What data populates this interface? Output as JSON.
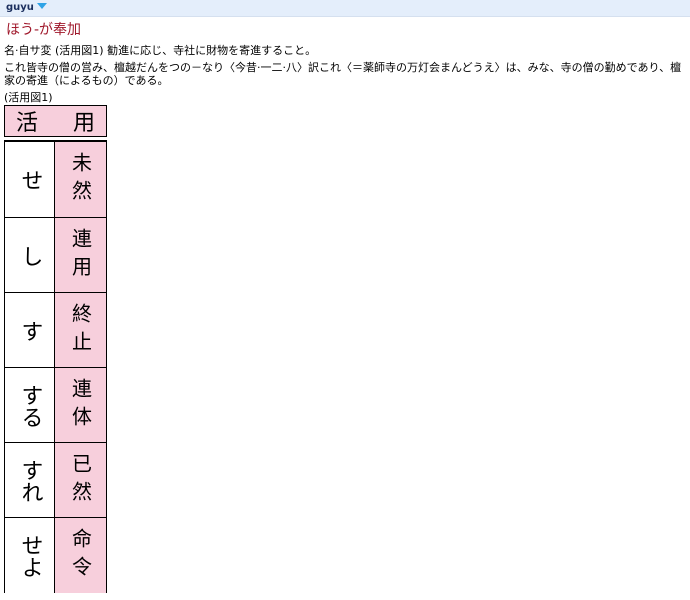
{
  "header": {
    "dictionary": "guyu"
  },
  "entry": {
    "headword": "ほう-が奉加",
    "grammar": "名·自サ変 (活用図1) 勧進に応じ、寺社に財物を寄進すること。",
    "text": "これ皆寺の僧の営み、檀越だんをつの－なり〈今昔·一二·八〉訳これ〈＝薬師寺の万灯会まんどうえ〉は、みな、寺の僧の勤めであり、檀家の寄進（によるもの）である。",
    "figure_caption": "(活用図1)"
  },
  "conjugation": {
    "header_left": "活",
    "header_right": "用",
    "rows": [
      {
        "ending": "せ",
        "form": "未然"
      },
      {
        "ending": "し",
        "form": "連用"
      },
      {
        "ending": "す",
        "form": "終止"
      },
      {
        "ending": "する",
        "form": "連体"
      },
      {
        "ending": "すれ",
        "form": "已然"
      },
      {
        "ending": "せよ",
        "form": "命令"
      }
    ]
  },
  "colors": {
    "topbar": "#e4eefb",
    "headword": "#a0182b",
    "cell_pink": "#f7cfdc",
    "dropdown_arrow": "#2fa3e6"
  }
}
